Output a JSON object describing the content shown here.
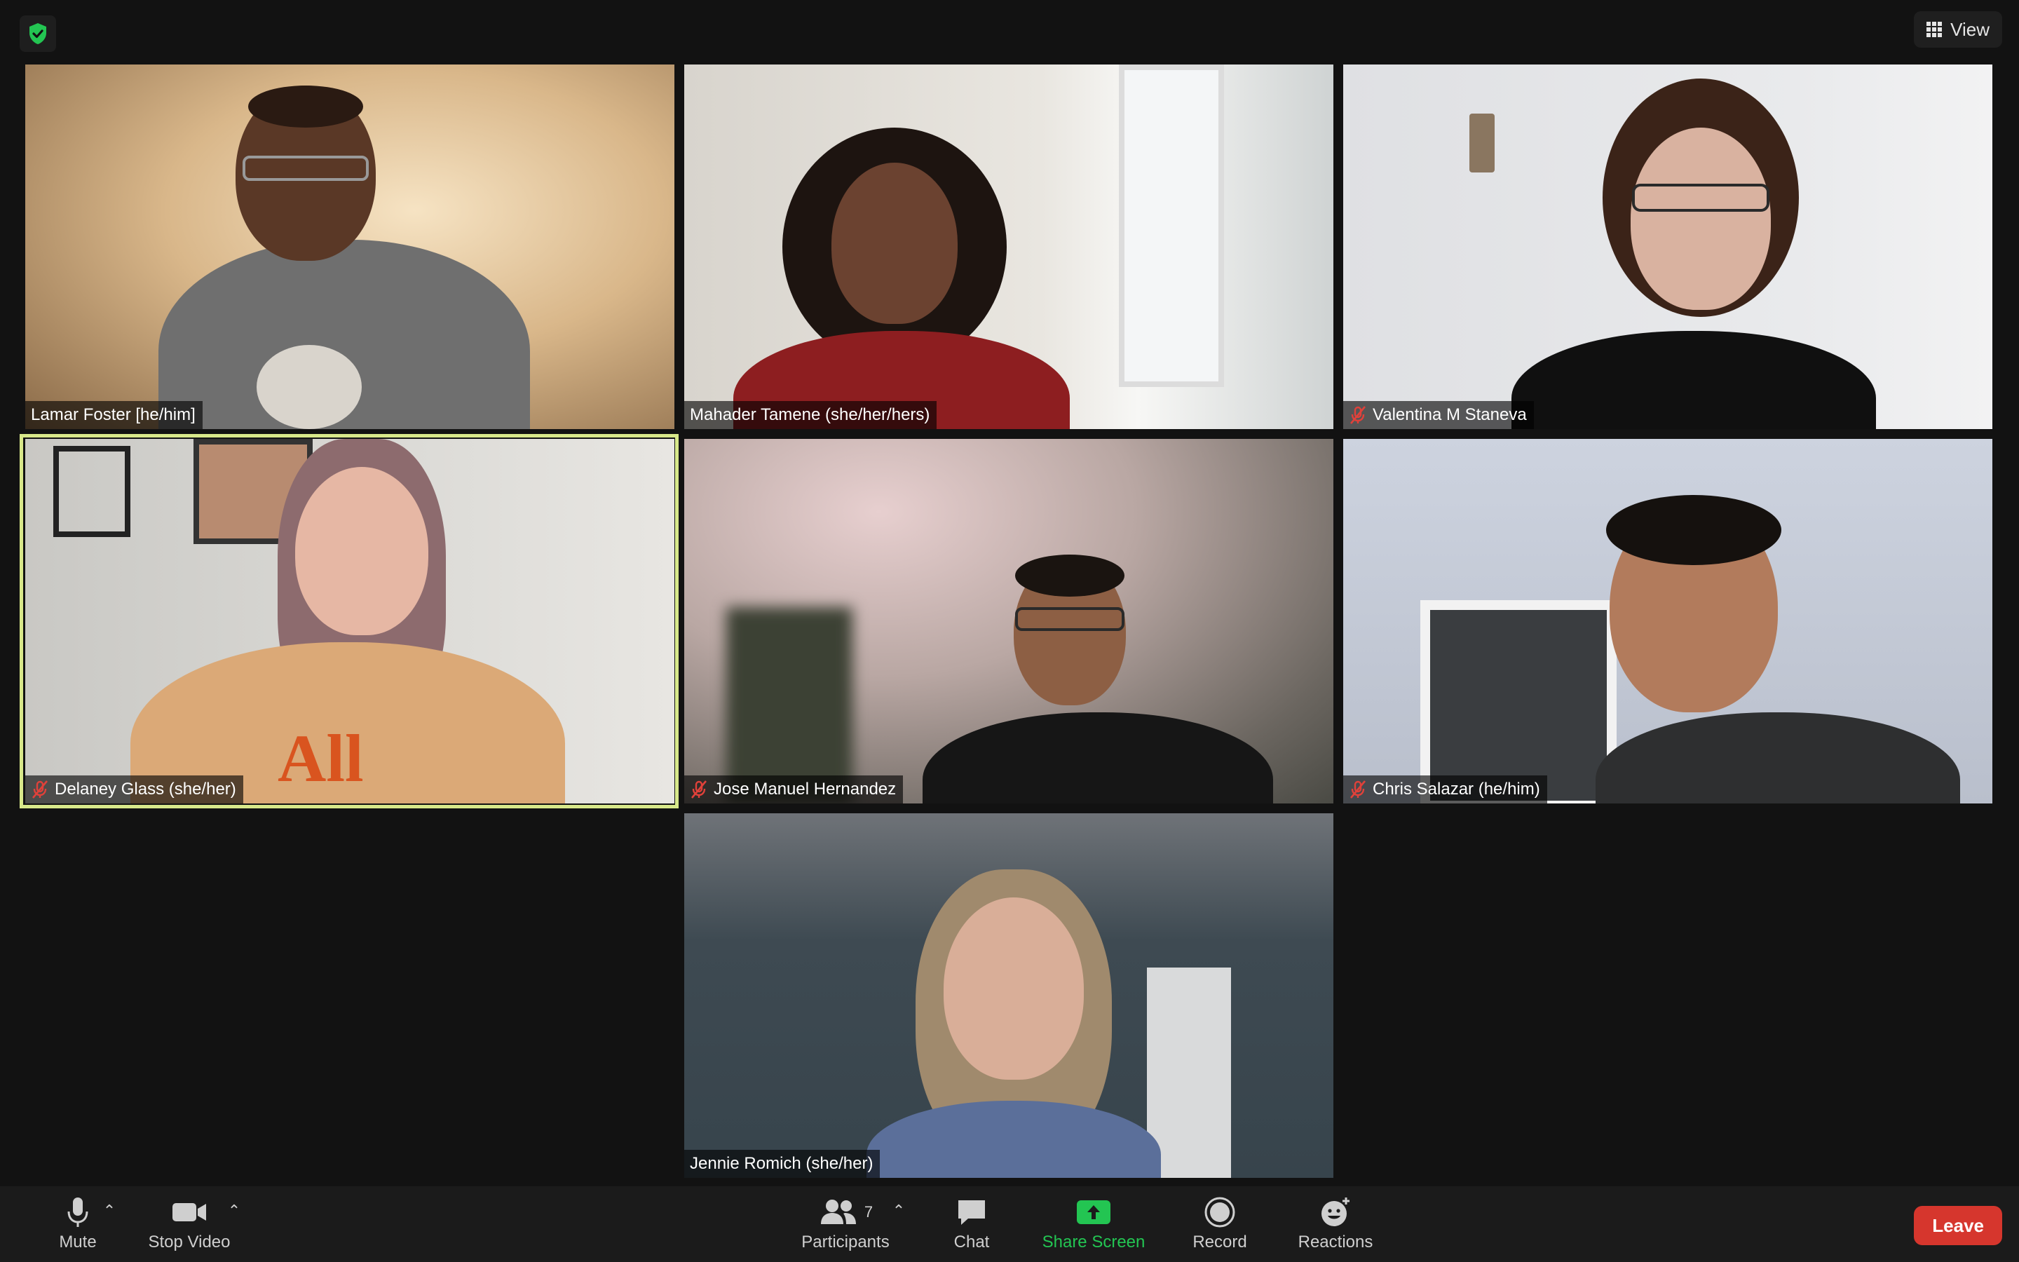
{
  "top_bar": {
    "security_icon": "shield-check-icon",
    "view_label": "View"
  },
  "participants": [
    {
      "name": "Lamar Foster [he/him]",
      "muted": false,
      "active_speaker": false
    },
    {
      "name": "Mahader Tamene (she/her/hers)",
      "muted": false,
      "active_speaker": false
    },
    {
      "name": "Valentina M Staneva",
      "muted": true,
      "active_speaker": false
    },
    {
      "name": "Delaney Glass (she/her)",
      "muted": true,
      "active_speaker": true
    },
    {
      "name": "Jose Manuel Hernandez",
      "muted": true,
      "active_speaker": false
    },
    {
      "name": "Chris Salazar (he/him)",
      "muted": true,
      "active_speaker": false
    },
    {
      "name": "Jennie Romich (she/her)",
      "muted": false,
      "active_speaker": false
    }
  ],
  "toolbar": {
    "mute_label": "Mute",
    "stop_video_label": "Stop Video",
    "participants_label": "Participants",
    "participants_count": "7",
    "chat_label": "Chat",
    "share_screen_label": "Share Screen",
    "record_label": "Record",
    "reactions_label": "Reactions",
    "leave_label": "Leave"
  },
  "colors": {
    "active_speaker_border": "#d8e88a",
    "share_screen_green": "#23c552",
    "leave_red": "#d6362d",
    "muted_red": "#e0413a"
  }
}
